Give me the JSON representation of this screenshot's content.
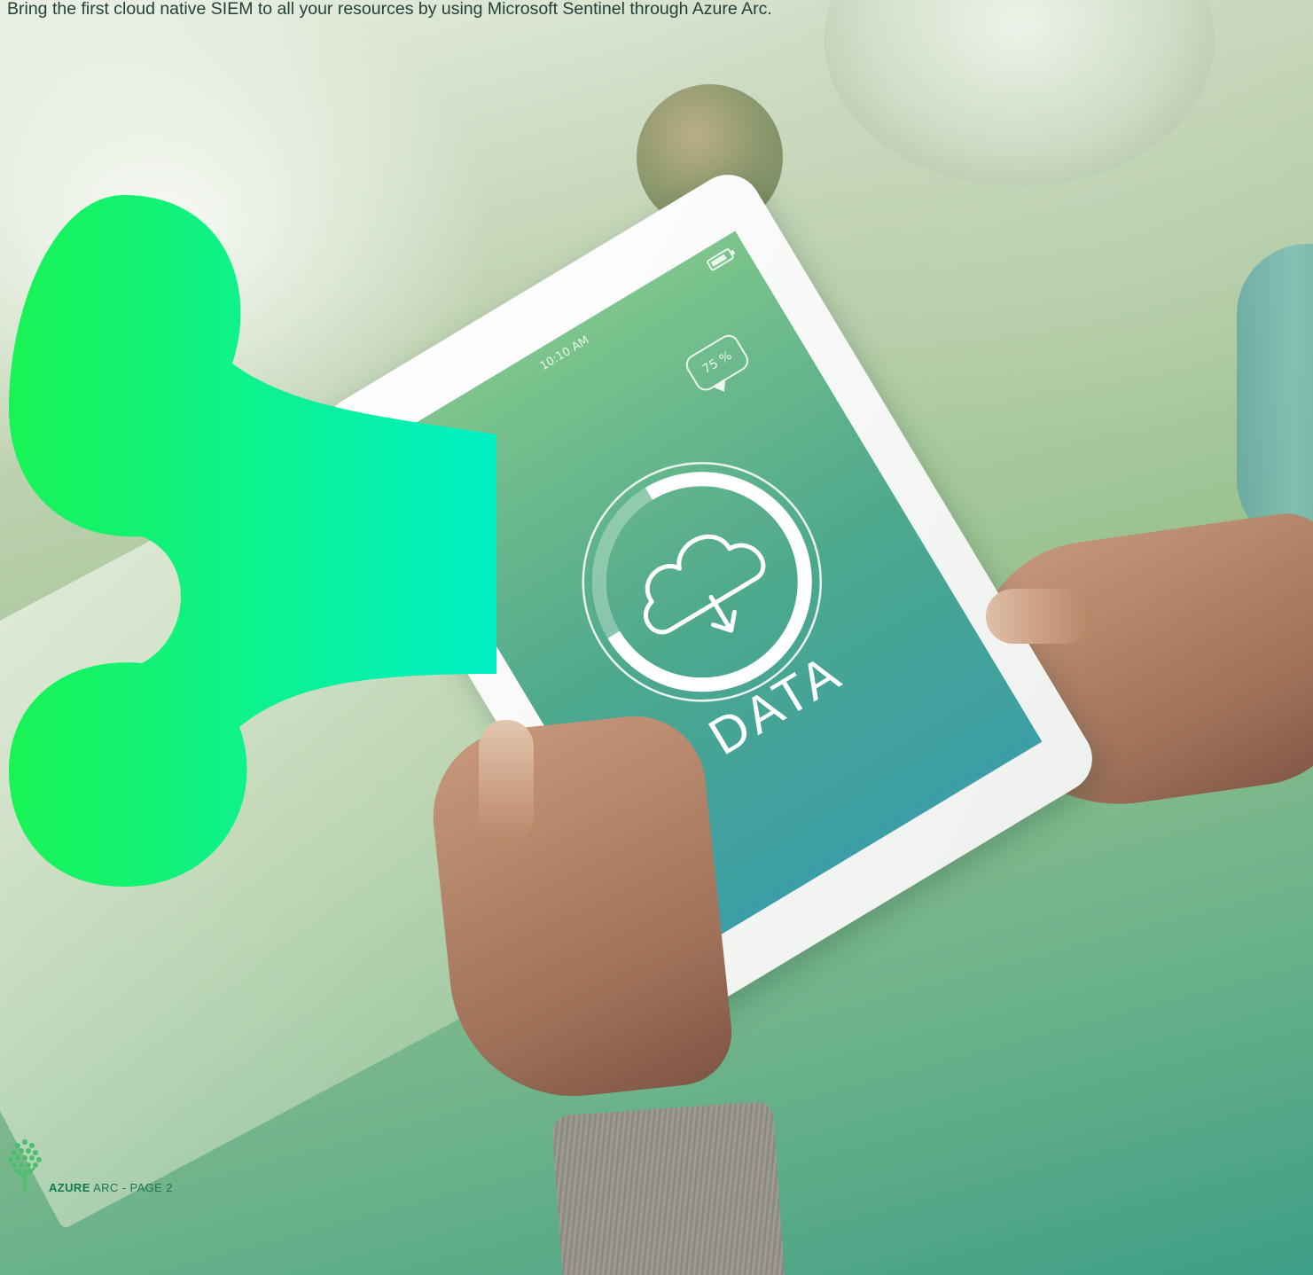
{
  "header": {
    "intro_text": "Bring the first cloud native SIEM to all your resources by using Microsoft Sentinel through Azure Arc."
  },
  "tablet_screen": {
    "time": "10:10 AM",
    "signal_dots": "●●●○",
    "battery_percent": "75 %",
    "download_ring_progress": 0.75,
    "label": "DATA"
  },
  "footer": {
    "brand_word": "AZURE",
    "page_label": " ARC - PAGE 2"
  },
  "colors": {
    "blob_gradient_start": "#19f354",
    "blob_gradient_end": "#00f0c6",
    "footer_accent": "#0f7b46",
    "screen_top": "#7dc48c",
    "screen_bottom": "#3c9ea6"
  },
  "icons": {
    "cloud": "cloud-download-icon",
    "battery": "battery-icon",
    "logo": "tree-logo-icon"
  }
}
